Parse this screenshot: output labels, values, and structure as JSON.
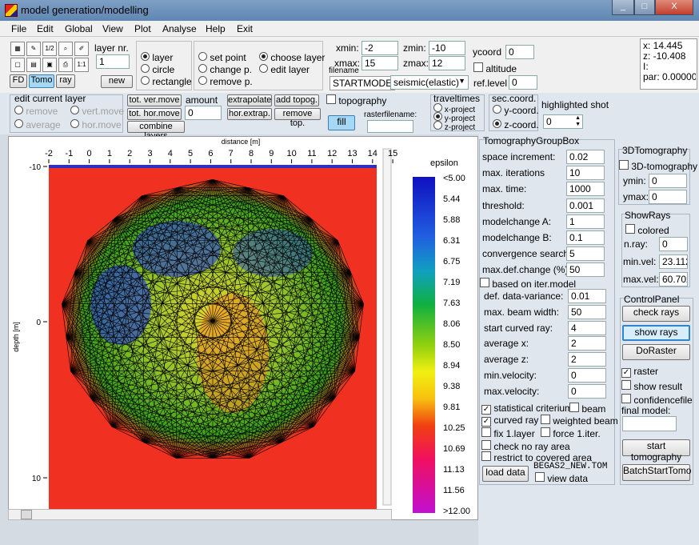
{
  "window": {
    "title": "model generation/modelling",
    "controls": [
      "_",
      "□",
      "X"
    ]
  },
  "menu": [
    {
      "label": "File",
      "key": "F"
    },
    {
      "label": "Edit",
      "key": "E"
    },
    {
      "label": "Global",
      "key": "G"
    },
    {
      "label": "View",
      "key": "V"
    },
    {
      "label": "Plot",
      "key": "P"
    },
    {
      "label": "Analyse",
      "key": "A"
    },
    {
      "label": "Help",
      "key": "H"
    },
    {
      "label": "Exit",
      "key": "E"
    }
  ],
  "toolbar": {
    "mode_buttons": [
      "FD",
      "Tomo",
      "ray"
    ],
    "small_tools": [
      "1/2",
      "1:1"
    ],
    "layer_nr_label": "layer nr.",
    "layer_nr_value": "1",
    "new_label": "new",
    "shape_radios": [
      "layer",
      "circle",
      "rectangle"
    ],
    "point_radios": [
      "set point",
      "change p.",
      "remove p."
    ],
    "layer_radios": [
      "choose layer",
      "edit layer"
    ],
    "xmin_label": "xmin:",
    "xmin_value": "-2",
    "xmax_label": "xmax:",
    "xmax_value": "15",
    "zmin_label": "zmin:",
    "zmin_value": "-10",
    "zmax_label": "zmax:",
    "zmax_value": "12",
    "filename_label": "filename",
    "startmode_label": "STARTMODE",
    "startmode_value": "seismic(elastic)",
    "ycoord_label": "ycoord",
    "ycoord_value": "0",
    "altitude_label": "altitude",
    "reflevel_label": "ref.level",
    "reflevel_value": "0",
    "coords": {
      "x": "x: 14.445",
      "z": "z: -10.408",
      "i": "I:",
      "par": "par: 0.00000"
    }
  },
  "edit_layer": {
    "title": "edit current layer",
    "radios": [
      "remove",
      "vert.move",
      "average",
      "hor.move"
    ],
    "buttons": [
      "tot. ver.move",
      "tot. hor.move",
      "combine layers"
    ],
    "amount_label": "amount",
    "amount_value": "0",
    "extra_buttons": [
      "extrapolate",
      "add topog.",
      "hor.extrap.",
      "remove top."
    ],
    "topography_label": "topography",
    "fill_label": "fill",
    "rasterfilename_label": "rasterfilename:",
    "traveltimes_label": "traveltimes",
    "project_radios": [
      "x-project",
      "y-project",
      "z-project"
    ],
    "seccoord_label": "sec.coord.",
    "seccoord_radios": [
      "y-coord.",
      "z-coord."
    ],
    "highlighted_shot_label": "highlighted shot",
    "highlighted_shot_value": "0"
  },
  "plot": {
    "title": "distance [m]",
    "ylabel": "depth [m]",
    "xticks": [
      "-2",
      "-1",
      "0",
      "1",
      "2",
      "3",
      "4",
      "5",
      "6",
      "7",
      "8",
      "9",
      "10",
      "11",
      "12",
      "13",
      "14",
      "15"
    ],
    "yticks": [
      "-10",
      "0",
      "10"
    ],
    "legend_title": "epsilon",
    "legend_labels": [
      "<5.00",
      "5.44",
      "5.88",
      "6.31",
      "6.75",
      "7.19",
      "7.63",
      "8.06",
      "8.50",
      "8.94",
      "9.38",
      "9.81",
      "10.25",
      "10.69",
      "11.13",
      "11.56",
      ">12.00"
    ],
    "colors": {
      "background": "#f03020",
      "blue": "#3050c8",
      "green": "#40a020",
      "yellow": "#e8e020"
    }
  },
  "tomo": {
    "title": "TomographyGroupBox",
    "fields": [
      {
        "label": "space increment:",
        "value": "0.02"
      },
      {
        "label": "max. iterations",
        "value": "10"
      },
      {
        "label": "max. time:",
        "value": "1000"
      },
      {
        "label": "threshold:",
        "value": "0.001"
      },
      {
        "label": "modelchange A:",
        "value": "1"
      },
      {
        "label": "modelchange B:",
        "value": "0.1"
      },
      {
        "label": "convergence search:",
        "value": "5"
      },
      {
        "label": "max.def.change (%)",
        "value": "50"
      }
    ],
    "based_label": "based on iter.model",
    "fields2": [
      {
        "label": "def. data-variance:",
        "value": "0.01"
      },
      {
        "label": "max. beam width:",
        "value": "50"
      },
      {
        "label": "start curved ray:",
        "value": "4"
      },
      {
        "label": "average x:",
        "value": "2"
      },
      {
        "label": "average z:",
        "value": "2"
      },
      {
        "label": "min.velocity:",
        "value": "0"
      },
      {
        "label": "max.velocity:",
        "value": "0"
      }
    ],
    "checks": [
      {
        "label": "statistical criterium",
        "checked": true
      },
      {
        "label": "beam",
        "checked": false
      },
      {
        "label": "curved ray",
        "checked": true
      },
      {
        "label": "weighted beam",
        "checked": false
      },
      {
        "label": "fix 1.layer",
        "checked": false
      },
      {
        "label": "force 1.iter.",
        "checked": false
      },
      {
        "label": "check no ray area",
        "checked": false
      },
      {
        "label": "restrict to covered area",
        "checked": false
      }
    ],
    "load_data_label": "load data",
    "filename": "BEGAS2_NEW.TOM",
    "view_data_label": "view data"
  },
  "tomo3d": {
    "title": "3DTomography",
    "check_label": "3D-tomography",
    "ymin_label": "ymin:",
    "ymin_value": "0",
    "ymax_label": "ymax:",
    "ymax_value": "0"
  },
  "showrays": {
    "title": "ShowRays",
    "colored_label": "colored",
    "nray_label": "n.ray:",
    "nray_value": "0",
    "minvel_label": "min.vel:",
    "minvel_value": "23.112",
    "maxvel_label": "max.vel:",
    "maxvel_value": "60.702"
  },
  "control": {
    "title": "ControlPanel",
    "buttons": [
      "check rays",
      "show rays",
      "DoRaster"
    ],
    "raster_label": "raster",
    "show_result_label": "show result",
    "confidence_label": "confidencefile",
    "final_model_label": "final model:",
    "start_label": "start tomography",
    "batch_label": "BatchStartTomo"
  }
}
